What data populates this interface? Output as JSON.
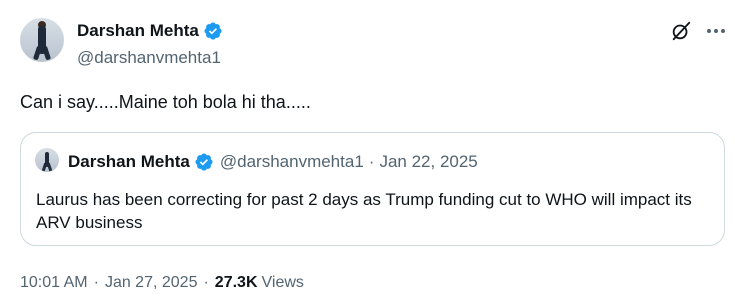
{
  "author": {
    "name": "Darshan Mehta",
    "handle": "@darshanvmehta1"
  },
  "tweet": {
    "text": "Can i say.....Maine toh bola hi tha....."
  },
  "quoted_tweet": {
    "name": "Darshan Mehta",
    "handle": "@darshanvmehta1",
    "separator": "·",
    "date": "Jan 22, 2025",
    "text": "Laurus has been correcting for past 2 days as Trump funding cut to WHO will impact its ARV business"
  },
  "meta": {
    "time": "10:01 AM",
    "separator": "·",
    "date": "Jan 27, 2025",
    "views_count": "27.3K",
    "views_label": "Views"
  },
  "colors": {
    "verified": "#1d9bf0",
    "secondary_text": "#536471",
    "border": "#cfd9de"
  },
  "icons": [
    "verified-badge-icon",
    "grok-icon",
    "more-icon"
  ]
}
